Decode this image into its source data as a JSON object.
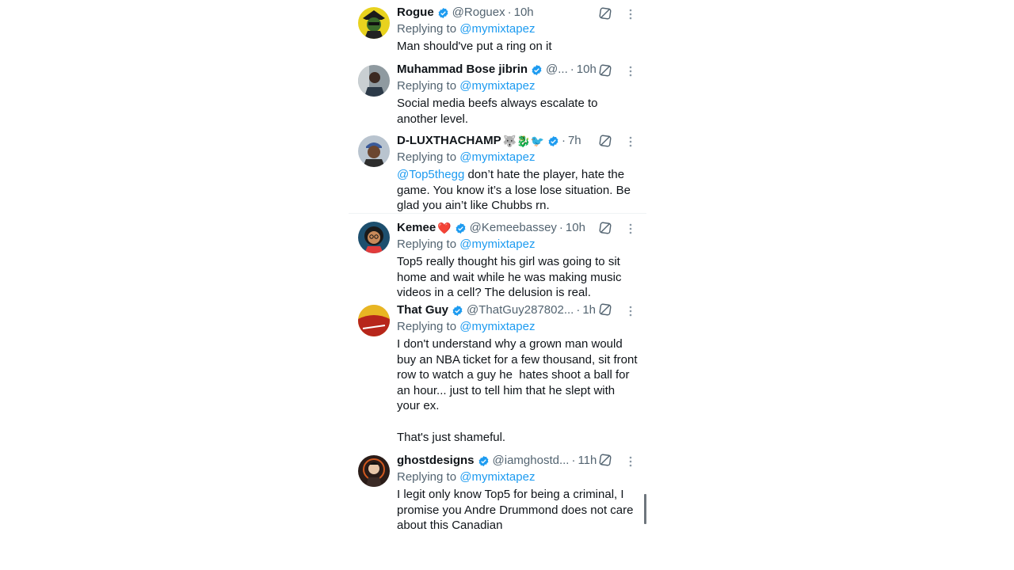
{
  "colors": {
    "accent": "#1d9bf0",
    "secondary_text": "#536471",
    "primary_text": "#0f1419"
  },
  "replies": [
    {
      "name": "Rogue",
      "handle": "@Roguex",
      "time": "10h",
      "replying_prefix": "Replying to",
      "replying_to": "@mymixtapez",
      "text": "Man should've put a ring on it",
      "avatar_icon": "avatar-cartoon-icon"
    },
    {
      "name": "Muhammad Bose jibrin",
      "handle": "@...",
      "time": "10h",
      "replying_prefix": "Replying to",
      "replying_to": "@mymixtapez",
      "text": "Social media beefs always escalate to another level.",
      "avatar_icon": "avatar-photo-icon"
    },
    {
      "name": "D-LUXTHACHAMP",
      "name_emoji": "🐺🐉🐦",
      "handle": "",
      "time": "7h",
      "replying_prefix": "Replying to",
      "replying_to": "@mymixtapez",
      "text_mention": "@Top5thegg",
      "text": " don’t hate the player, hate the game. You know it’s a lose lose situation. Be glad you ain’t like Chubbs rn.",
      "avatar_icon": "avatar-photo-icon"
    },
    {
      "name": "Kemee",
      "name_emoji": "❤️",
      "handle": "@Kemeebassey",
      "time": "10h",
      "replying_prefix": "Replying to",
      "replying_to": "@mymixtapez",
      "text": "Top5 really thought his girl was going to sit home and wait while he was making music videos in a cell? The delusion is real.",
      "avatar_icon": "avatar-illustration-icon"
    },
    {
      "name": "That Guy",
      "handle": "@ThatGuy287802...",
      "time": "1h",
      "replying_prefix": "Replying to",
      "replying_to": "@mymixtapez",
      "text": "I don't understand why a grown man would buy an NBA ticket for a few thousand, sit front row to watch a guy he  hates shoot a ball for an hour... just to tell him that he slept with your ex.\n\nThat's just shameful.",
      "avatar_icon": "avatar-logo-icon"
    },
    {
      "name": "ghostdesigns",
      "handle": "@iamghostd...",
      "time": "11h",
      "replying_prefix": "Replying to",
      "replying_to": "@mymixtapez",
      "text": "I legit only know Top5 for being a criminal, I promise you Andre Drummond does not care about this Canadian",
      "avatar_icon": "avatar-character-icon"
    }
  ],
  "icons": {
    "verified": "verified-badge-icon",
    "grok": "grok-icon",
    "more": "more-options-icon"
  }
}
